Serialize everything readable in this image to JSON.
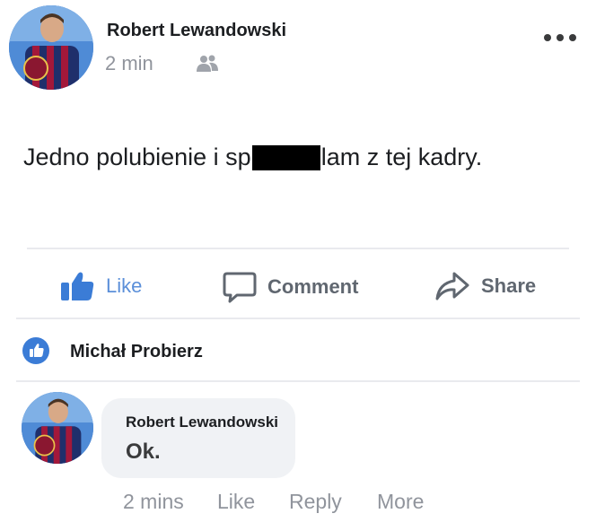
{
  "post": {
    "author": "Robert Lewandowski",
    "time": "2 min",
    "audience_icon": "friends-icon",
    "menu_icon": "more-horizontal-icon",
    "text_before": "Jedno polubienie i sp",
    "text_after": "lam z tej kadry."
  },
  "actions": {
    "like_label": "Like",
    "comment_label": "Comment",
    "share_label": "Share"
  },
  "reactions": {
    "icon": "like-badge-icon",
    "name": "Michał Probierz"
  },
  "comment": {
    "author": "Robert Lewandowski",
    "text": "Ok.",
    "time": "2 mins",
    "like_label": "Like",
    "reply_label": "Reply",
    "more_label": "More"
  },
  "colors": {
    "accent": "#3b7cd6",
    "muted_text": "#90949c",
    "divider": "#e9eaee",
    "bubble": "#f0f2f5"
  }
}
